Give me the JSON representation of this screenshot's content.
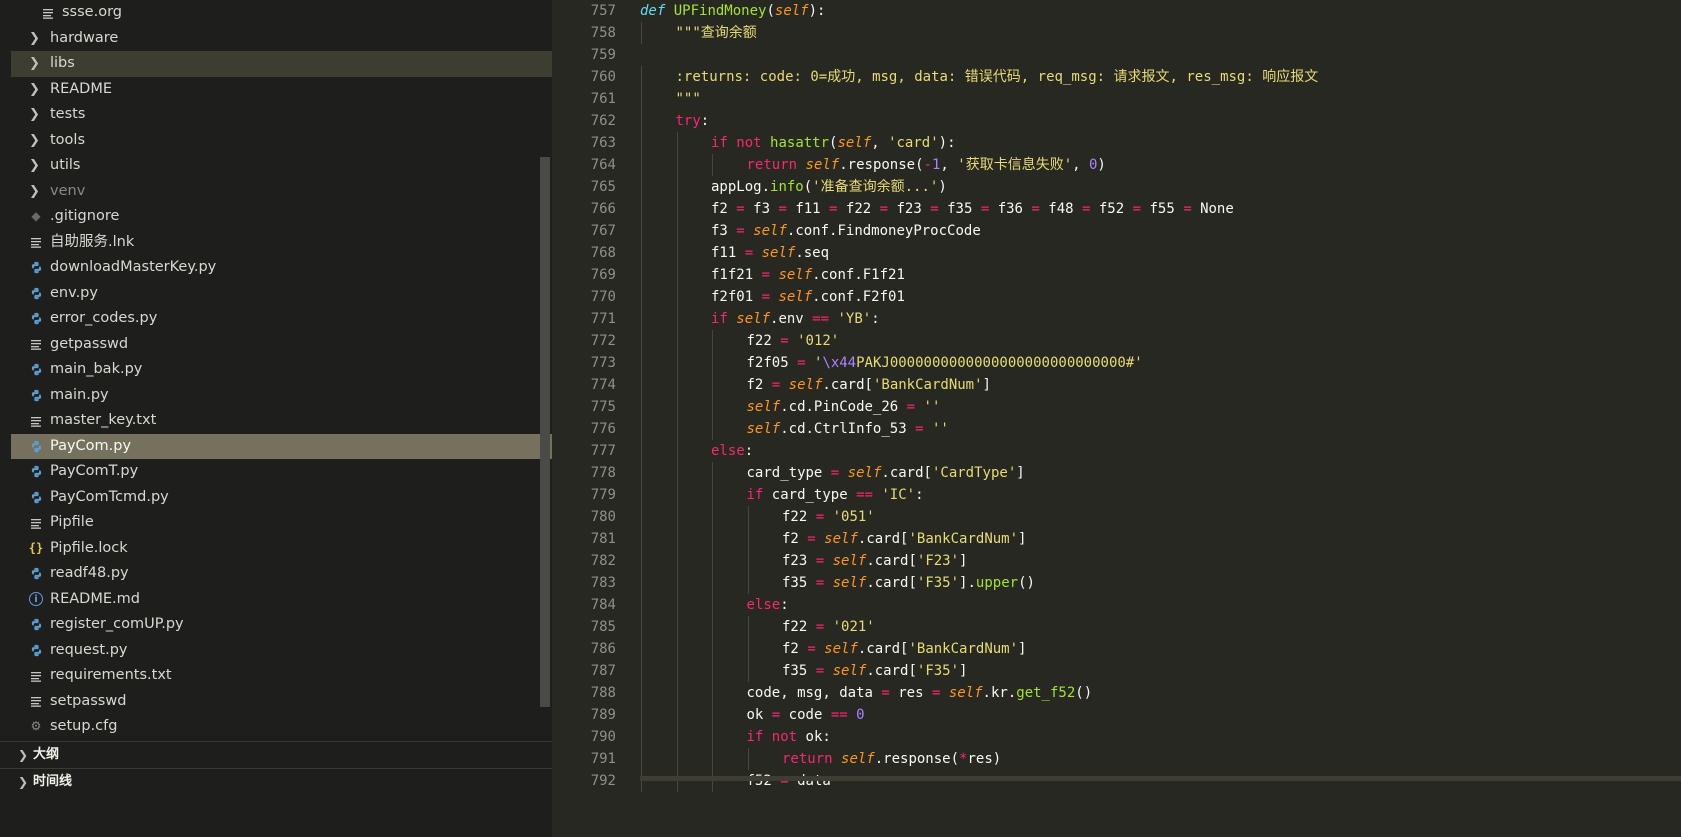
{
  "explorer": {
    "items": [
      {
        "label": "ssse.org",
        "icon": "lines-icon",
        "indent": "sub"
      },
      {
        "label": "hardware",
        "icon": "chevron-right-icon"
      },
      {
        "label": "libs",
        "icon": "chevron-right-icon",
        "state": "hover"
      },
      {
        "label": "README",
        "icon": "chevron-right-icon"
      },
      {
        "label": "tests",
        "icon": "chevron-right-icon"
      },
      {
        "label": "tools",
        "icon": "chevron-right-icon"
      },
      {
        "label": "utils",
        "icon": "chevron-right-icon"
      },
      {
        "label": "venv",
        "icon": "chevron-right-icon",
        "state": "muted"
      },
      {
        "label": ".gitignore",
        "icon": "diamond-icon"
      },
      {
        "label": "自助服务.lnk",
        "icon": "lines-icon"
      },
      {
        "label": "downloadMasterKey.py",
        "icon": "python-icon"
      },
      {
        "label": "env.py",
        "icon": "python-icon"
      },
      {
        "label": "error_codes.py",
        "icon": "python-icon"
      },
      {
        "label": "getpasswd",
        "icon": "lines-icon"
      },
      {
        "label": "main_bak.py",
        "icon": "python-icon"
      },
      {
        "label": "main.py",
        "icon": "python-icon"
      },
      {
        "label": "master_key.txt",
        "icon": "lines-icon"
      },
      {
        "label": "PayCom.py",
        "icon": "python-icon",
        "state": "active"
      },
      {
        "label": "PayComT.py",
        "icon": "python-icon"
      },
      {
        "label": "PayComTcmd.py",
        "icon": "python-icon"
      },
      {
        "label": "Pipfile",
        "icon": "lines-icon"
      },
      {
        "label": "Pipfile.lock",
        "icon": "braces-icon"
      },
      {
        "label": "readf48.py",
        "icon": "python-icon"
      },
      {
        "label": "README.md",
        "icon": "info-icon"
      },
      {
        "label": "register_comUP.py",
        "icon": "python-icon"
      },
      {
        "label": "request.py",
        "icon": "python-icon"
      },
      {
        "label": "requirements.txt",
        "icon": "lines-icon"
      },
      {
        "label": "setpasswd",
        "icon": "lines-icon"
      },
      {
        "label": "setup.cfg",
        "icon": "gear-icon"
      }
    ],
    "sections": [
      {
        "label": "大纲",
        "icon": "chevron-right-icon"
      },
      {
        "label": "时间线",
        "icon": "chevron-right-icon"
      }
    ]
  },
  "editor": {
    "line_numbers": [
      "757",
      "758",
      "759",
      "760",
      "761",
      "762",
      "763",
      "764",
      "765",
      "766",
      "767",
      "768",
      "769",
      "770",
      "771",
      "772",
      "773",
      "774",
      "775",
      "776",
      "777",
      "778",
      "779",
      "780",
      "781",
      "782",
      "783",
      "784",
      "785",
      "786",
      "787",
      "788",
      "789",
      "790",
      "791",
      "792"
    ],
    "lines": [
      {
        "indent": 1,
        "tokens": [
          {
            "t": "def",
            "c": "def"
          },
          {
            "t": " "
          },
          {
            "t": "UPFindMoney",
            "c": "fn"
          },
          {
            "t": "("
          },
          {
            "t": "self",
            "c": "self"
          },
          {
            "t": "):"
          }
        ]
      },
      {
        "indent": 2,
        "tokens": [
          {
            "t": "\"\"\"查询余额",
            "c": "doc"
          }
        ]
      },
      {
        "indent": 0,
        "tokens": []
      },
      {
        "indent": 2,
        "tokens": [
          {
            "t": ":returns: code: 0=成功, msg, data: 错误代码, req_msg: 请求报文, res_msg: 响应报文",
            "c": "doc"
          }
        ]
      },
      {
        "indent": 2,
        "tokens": [
          {
            "t": "\"\"\"",
            "c": "doc"
          }
        ]
      },
      {
        "indent": 2,
        "tokens": [
          {
            "t": "try",
            "c": "kw"
          },
          {
            "t": ":"
          }
        ]
      },
      {
        "indent": 3,
        "tokens": [
          {
            "t": "if",
            "c": "kw"
          },
          {
            "t": " "
          },
          {
            "t": "not",
            "c": "kw"
          },
          {
            "t": " "
          },
          {
            "t": "hasattr",
            "c": "fn"
          },
          {
            "t": "("
          },
          {
            "t": "self",
            "c": "self"
          },
          {
            "t": ", "
          },
          {
            "t": "'card'",
            "c": "str"
          },
          {
            "t": "):"
          }
        ]
      },
      {
        "indent": 4,
        "tokens": [
          {
            "t": "return",
            "c": "kw"
          },
          {
            "t": " "
          },
          {
            "t": "self",
            "c": "self"
          },
          {
            "t": ".response("
          },
          {
            "t": "-",
            "c": "op"
          },
          {
            "t": "1",
            "c": "num"
          },
          {
            "t": ", "
          },
          {
            "t": "'获取卡信息失败'",
            "c": "str"
          },
          {
            "t": ", "
          },
          {
            "t": "0",
            "c": "num"
          },
          {
            "t": ")"
          }
        ]
      },
      {
        "indent": 3,
        "tokens": [
          {
            "t": "appLog."
          },
          {
            "t": "info",
            "c": "fn"
          },
          {
            "t": "("
          },
          {
            "t": "'准备查询余额...'",
            "c": "str"
          },
          {
            "t": ")"
          }
        ]
      },
      {
        "indent": 3,
        "tokens": [
          {
            "t": "f2 "
          },
          {
            "t": "=",
            "c": "op"
          },
          {
            "t": " f3 "
          },
          {
            "t": "=",
            "c": "op"
          },
          {
            "t": " f11 "
          },
          {
            "t": "=",
            "c": "op"
          },
          {
            "t": " f22 "
          },
          {
            "t": "=",
            "c": "op"
          },
          {
            "t": " f23 "
          },
          {
            "t": "=",
            "c": "op"
          },
          {
            "t": " f35 "
          },
          {
            "t": "=",
            "c": "op"
          },
          {
            "t": " f36 "
          },
          {
            "t": "=",
            "c": "op"
          },
          {
            "t": " f48 "
          },
          {
            "t": "=",
            "c": "op"
          },
          {
            "t": " f52 "
          },
          {
            "t": "=",
            "c": "op"
          },
          {
            "t": " f55 "
          },
          {
            "t": "=",
            "c": "op"
          },
          {
            "t": " None"
          }
        ]
      },
      {
        "indent": 3,
        "tokens": [
          {
            "t": "f3 "
          },
          {
            "t": "=",
            "c": "op"
          },
          {
            "t": " "
          },
          {
            "t": "self",
            "c": "self"
          },
          {
            "t": ".conf.FindmoneyProcCode"
          }
        ]
      },
      {
        "indent": 3,
        "tokens": [
          {
            "t": "f11 "
          },
          {
            "t": "=",
            "c": "op"
          },
          {
            "t": " "
          },
          {
            "t": "self",
            "c": "self"
          },
          {
            "t": ".seq"
          }
        ]
      },
      {
        "indent": 3,
        "tokens": [
          {
            "t": "f1f21 "
          },
          {
            "t": "=",
            "c": "op"
          },
          {
            "t": " "
          },
          {
            "t": "self",
            "c": "self"
          },
          {
            "t": ".conf.F1f21"
          }
        ]
      },
      {
        "indent": 3,
        "tokens": [
          {
            "t": "f2f01 "
          },
          {
            "t": "=",
            "c": "op"
          },
          {
            "t": " "
          },
          {
            "t": "self",
            "c": "self"
          },
          {
            "t": ".conf.F2f01"
          }
        ]
      },
      {
        "indent": 3,
        "tokens": [
          {
            "t": "if",
            "c": "kw"
          },
          {
            "t": " "
          },
          {
            "t": "self",
            "c": "self"
          },
          {
            "t": ".env "
          },
          {
            "t": "==",
            "c": "op"
          },
          {
            "t": " "
          },
          {
            "t": "'YB'",
            "c": "str"
          },
          {
            "t": ":"
          }
        ]
      },
      {
        "indent": 4,
        "tokens": [
          {
            "t": "f22 "
          },
          {
            "t": "=",
            "c": "op"
          },
          {
            "t": " "
          },
          {
            "t": "'012'",
            "c": "str"
          }
        ]
      },
      {
        "indent": 4,
        "tokens": [
          {
            "t": "f2f05 "
          },
          {
            "t": "=",
            "c": "op"
          },
          {
            "t": " "
          },
          {
            "t": "'",
            "c": "str"
          },
          {
            "t": "\\x44",
            "c": "esc"
          },
          {
            "t": "PAKJ0000000000000000000000000000#'",
            "c": "str"
          }
        ]
      },
      {
        "indent": 4,
        "tokens": [
          {
            "t": "f2 "
          },
          {
            "t": "=",
            "c": "op"
          },
          {
            "t": " "
          },
          {
            "t": "self",
            "c": "self"
          },
          {
            "t": ".card["
          },
          {
            "t": "'BankCardNum'",
            "c": "str"
          },
          {
            "t": "]"
          }
        ]
      },
      {
        "indent": 4,
        "tokens": [
          {
            "t": "self",
            "c": "self"
          },
          {
            "t": ".cd.PinCode_26 "
          },
          {
            "t": "=",
            "c": "op"
          },
          {
            "t": " "
          },
          {
            "t": "''",
            "c": "str"
          }
        ]
      },
      {
        "indent": 4,
        "tokens": [
          {
            "t": "self",
            "c": "self"
          },
          {
            "t": ".cd.CtrlInfo_53 "
          },
          {
            "t": "=",
            "c": "op"
          },
          {
            "t": " "
          },
          {
            "t": "''",
            "c": "str"
          }
        ]
      },
      {
        "indent": 3,
        "tokens": [
          {
            "t": "else",
            "c": "kw"
          },
          {
            "t": ":"
          }
        ]
      },
      {
        "indent": 4,
        "tokens": [
          {
            "t": "card_type "
          },
          {
            "t": "=",
            "c": "op"
          },
          {
            "t": " "
          },
          {
            "t": "self",
            "c": "self"
          },
          {
            "t": ".card["
          },
          {
            "t": "'CardType'",
            "c": "str"
          },
          {
            "t": "]"
          }
        ]
      },
      {
        "indent": 4,
        "tokens": [
          {
            "t": "if",
            "c": "kw"
          },
          {
            "t": " card_type "
          },
          {
            "t": "==",
            "c": "op"
          },
          {
            "t": " "
          },
          {
            "t": "'IC'",
            "c": "str"
          },
          {
            "t": ":"
          }
        ]
      },
      {
        "indent": 5,
        "tokens": [
          {
            "t": "f22 "
          },
          {
            "t": "=",
            "c": "op"
          },
          {
            "t": " "
          },
          {
            "t": "'051'",
            "c": "str"
          }
        ]
      },
      {
        "indent": 5,
        "tokens": [
          {
            "t": "f2 "
          },
          {
            "t": "=",
            "c": "op"
          },
          {
            "t": " "
          },
          {
            "t": "self",
            "c": "self"
          },
          {
            "t": ".card["
          },
          {
            "t": "'BankCardNum'",
            "c": "str"
          },
          {
            "t": "]"
          }
        ]
      },
      {
        "indent": 5,
        "tokens": [
          {
            "t": "f23 "
          },
          {
            "t": "=",
            "c": "op"
          },
          {
            "t": " "
          },
          {
            "t": "self",
            "c": "self"
          },
          {
            "t": ".card["
          },
          {
            "t": "'F23'",
            "c": "str"
          },
          {
            "t": "]"
          }
        ]
      },
      {
        "indent": 5,
        "tokens": [
          {
            "t": "f35 "
          },
          {
            "t": "=",
            "c": "op"
          },
          {
            "t": " "
          },
          {
            "t": "self",
            "c": "self"
          },
          {
            "t": ".card["
          },
          {
            "t": "'F35'",
            "c": "str"
          },
          {
            "t": "]."
          },
          {
            "t": "upper",
            "c": "fn"
          },
          {
            "t": "()"
          }
        ]
      },
      {
        "indent": 4,
        "tokens": [
          {
            "t": "else",
            "c": "kw"
          },
          {
            "t": ":"
          }
        ]
      },
      {
        "indent": 5,
        "tokens": [
          {
            "t": "f22 "
          },
          {
            "t": "=",
            "c": "op"
          },
          {
            "t": " "
          },
          {
            "t": "'021'",
            "c": "str"
          }
        ]
      },
      {
        "indent": 5,
        "tokens": [
          {
            "t": "f2 "
          },
          {
            "t": "=",
            "c": "op"
          },
          {
            "t": " "
          },
          {
            "t": "self",
            "c": "self"
          },
          {
            "t": ".card["
          },
          {
            "t": "'BankCardNum'",
            "c": "str"
          },
          {
            "t": "]"
          }
        ]
      },
      {
        "indent": 5,
        "tokens": [
          {
            "t": "f35 "
          },
          {
            "t": "=",
            "c": "op"
          },
          {
            "t": " "
          },
          {
            "t": "self",
            "c": "self"
          },
          {
            "t": ".card["
          },
          {
            "t": "'F35'",
            "c": "str"
          },
          {
            "t": "]"
          }
        ]
      },
      {
        "indent": 4,
        "tokens": [
          {
            "t": "code, msg, data "
          },
          {
            "t": "=",
            "c": "op"
          },
          {
            "t": " res "
          },
          {
            "t": "=",
            "c": "op"
          },
          {
            "t": " "
          },
          {
            "t": "self",
            "c": "self"
          },
          {
            "t": ".kr."
          },
          {
            "t": "get_f52",
            "c": "fn"
          },
          {
            "t": "()"
          }
        ]
      },
      {
        "indent": 4,
        "tokens": [
          {
            "t": "ok "
          },
          {
            "t": "=",
            "c": "op"
          },
          {
            "t": " code "
          },
          {
            "t": "==",
            "c": "op"
          },
          {
            "t": " "
          },
          {
            "t": "0",
            "c": "num"
          }
        ]
      },
      {
        "indent": 4,
        "tokens": [
          {
            "t": "if",
            "c": "kw"
          },
          {
            "t": " "
          },
          {
            "t": "not",
            "c": "kw"
          },
          {
            "t": " ok:"
          }
        ]
      },
      {
        "indent": 5,
        "tokens": [
          {
            "t": "return",
            "c": "kw"
          },
          {
            "t": " "
          },
          {
            "t": "self",
            "c": "self"
          },
          {
            "t": ".response("
          },
          {
            "t": "*",
            "c": "op"
          },
          {
            "t": "res)"
          }
        ]
      },
      {
        "indent": 4,
        "tokens": [
          {
            "t": "f52 "
          },
          {
            "t": "=",
            "c": "op"
          },
          {
            "t": " data"
          }
        ]
      }
    ],
    "colors": {
      "background": "#272822",
      "keyword": "#f92672",
      "function": "#a6e22e",
      "string": "#e6db74",
      "number": "#ae81ff",
      "self": "#fd971f"
    }
  }
}
